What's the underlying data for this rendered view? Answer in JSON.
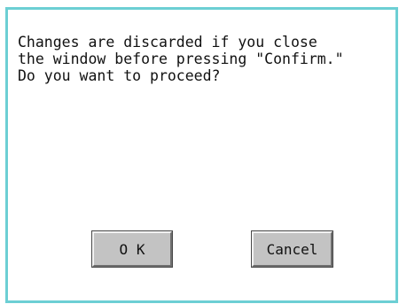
{
  "dialog": {
    "message": "Changes are discarded if you close\nthe window before pressing \"Confirm.\"\nDo you want to proceed?",
    "ok_label": "O K",
    "cancel_label": "Cancel"
  },
  "colors": {
    "border": "#6ccfd4",
    "button_face": "#c3c3c3",
    "background": "#ffffff"
  }
}
